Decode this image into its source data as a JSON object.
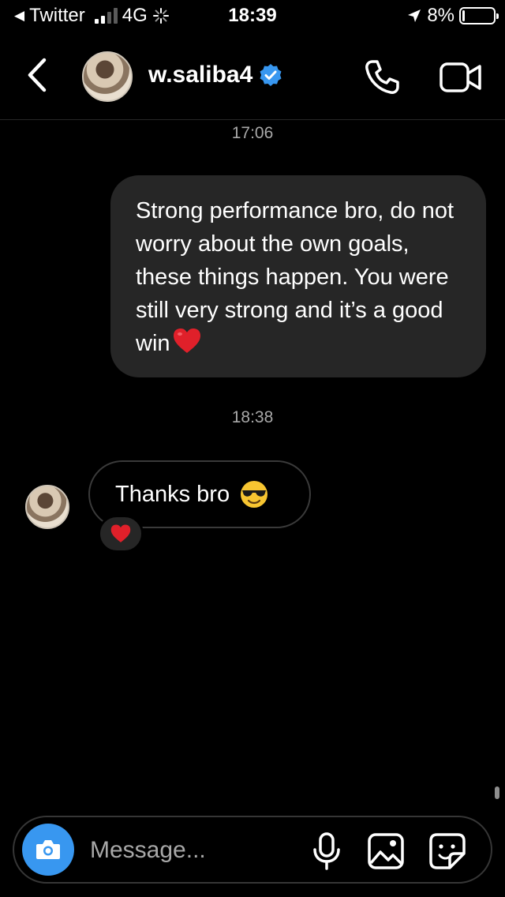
{
  "status_bar": {
    "back_app": "Twitter",
    "network": "4G",
    "time": "18:39",
    "battery": "8%",
    "battery_level": 0.08,
    "signal_bars_active": 2
  },
  "header": {
    "username": "w.saliba4",
    "verified": true,
    "icons": [
      "back-icon",
      "phone-icon",
      "video-icon"
    ]
  },
  "conversation": {
    "messages": [
      {
        "timestamp": "17:06"
      },
      {
        "direction": "outgoing",
        "text": "Strong performance bro, do not worry about the own goals, these things happen. You were still very strong and it’s a good win",
        "emoji": "red-heart"
      },
      {
        "timestamp": "18:38"
      },
      {
        "direction": "incoming",
        "text": "Thanks bro",
        "emoji": "smiling-face-with-sunglasses",
        "reaction": "red-heart"
      }
    ]
  },
  "composer": {
    "placeholder": "Message...",
    "icons": [
      "camera-icon",
      "microphone-icon",
      "gallery-icon",
      "sticker-icon"
    ]
  },
  "colors": {
    "background": "#000000",
    "outgoing_bubble": "#262626",
    "camera_button": "#3897f0",
    "verified_badge": "#3897f0",
    "heart": "#e0202a"
  }
}
